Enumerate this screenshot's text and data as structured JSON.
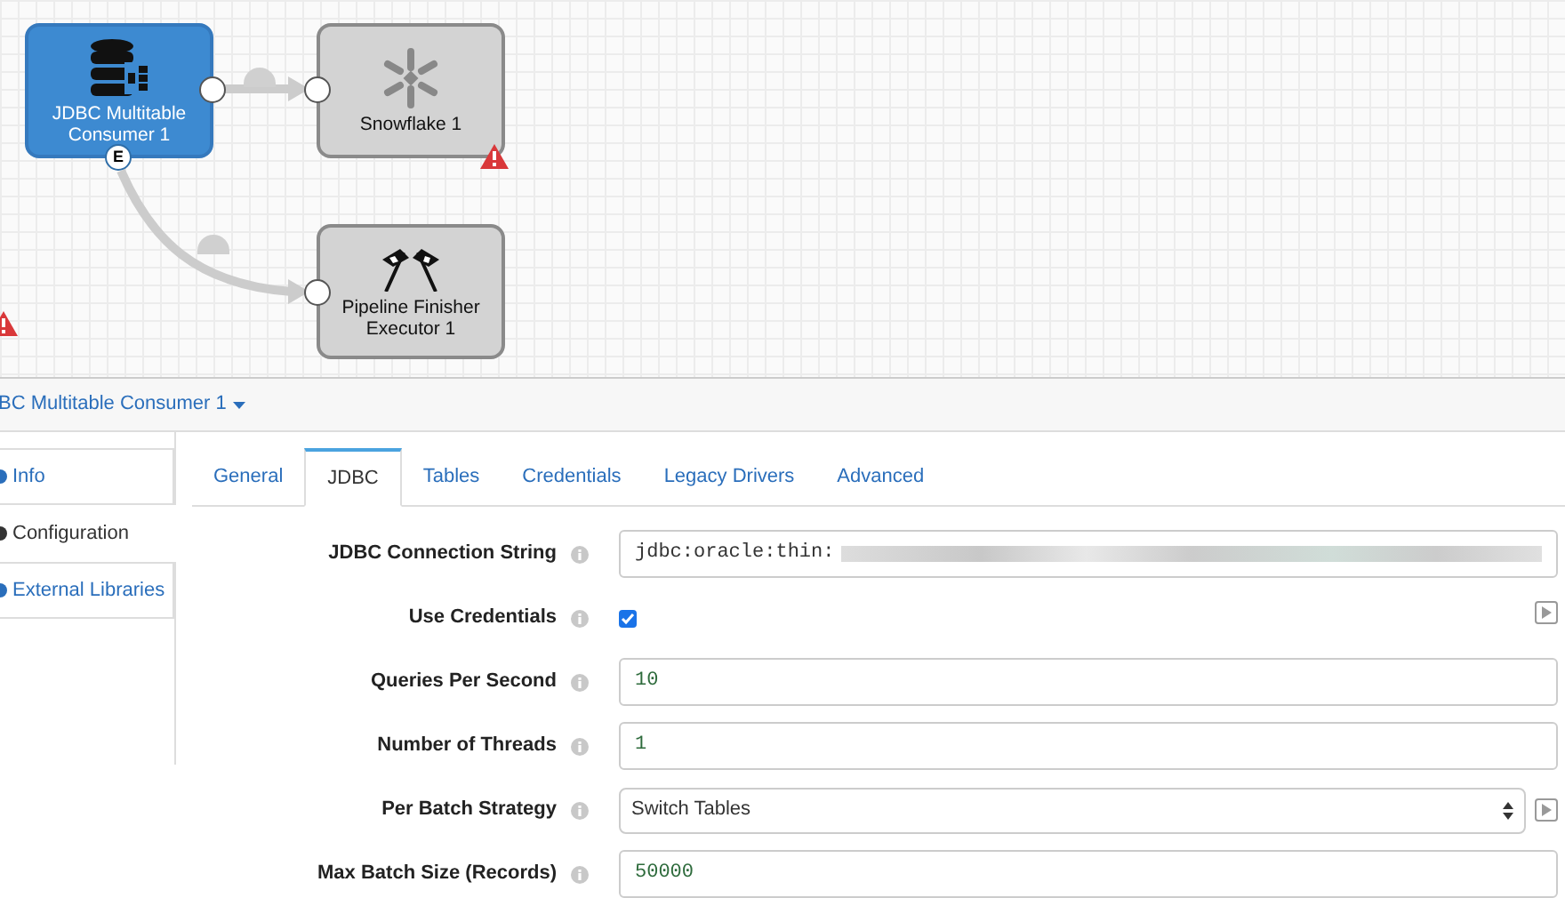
{
  "canvas": {
    "warning": true,
    "event_port": "E",
    "nodes": [
      {
        "label": "JDBC Multitable Consumer 1",
        "kind": "origin",
        "selected": true,
        "warning": false
      },
      {
        "label": "Snowflake 1",
        "kind": "destination",
        "selected": false,
        "warning": true
      },
      {
        "label": "Pipeline Finisher Executor 1",
        "kind": "executor",
        "selected": false,
        "warning": false
      }
    ]
  },
  "stage_title": "BC Multitable Consumer 1",
  "sidebar": {
    "items": [
      {
        "label": "Info",
        "selected": false
      },
      {
        "label": "Configuration",
        "selected": true
      },
      {
        "label": "External Libraries",
        "selected": false
      }
    ]
  },
  "tabs": [
    {
      "label": "General",
      "selected": false
    },
    {
      "label": "JDBC",
      "selected": true
    },
    {
      "label": "Tables",
      "selected": false
    },
    {
      "label": "Credentials",
      "selected": false
    },
    {
      "label": "Legacy Drivers",
      "selected": false
    },
    {
      "label": "Advanced",
      "selected": false
    }
  ],
  "fields": [
    {
      "kind": "text",
      "label": "JDBC Connection String",
      "value": "jdbc:oracle:thin:",
      "redacted": true,
      "side_button": false
    },
    {
      "kind": "checkbox",
      "label": "Use Credentials",
      "checked": true,
      "side_button": true
    },
    {
      "kind": "number",
      "label": "Queries Per Second",
      "value": "10",
      "side_button": false
    },
    {
      "kind": "number",
      "label": "Number of Threads",
      "value": "1",
      "side_button": false
    },
    {
      "kind": "select",
      "label": "Per Batch Strategy",
      "value": "Switch Tables",
      "side_button": true
    },
    {
      "kind": "number",
      "label": "Max Batch Size (Records)",
      "value": "50000",
      "side_button": false
    }
  ]
}
